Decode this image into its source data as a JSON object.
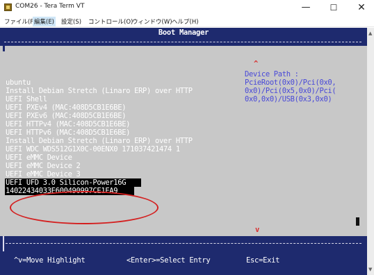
{
  "window": {
    "title": "COM26 - Tera Term VT",
    "minimize": "—",
    "maximize": "☐",
    "close": "✕"
  },
  "menu": [
    "ファイル(F)",
    "編集(E)",
    "設定(S)",
    "コントロール(O)",
    "ウィンドウ(W)",
    "ヘルプ(H)"
  ],
  "terminal": {
    "header_title": "Boot Manager",
    "entries": [
      "ubuntu",
      "Install Debian Stretch (Linaro ERP) over HTTP",
      "UEFI Shell",
      "UEFI PXEv4 (MAC:408D5CB1E6BE)",
      "UEFI PXEv6 (MAC:408D5CB1E6BE)",
      "UEFI HTTPv4 (MAC:408D5CB1E6BE)",
      "UEFI HTTPv6 (MAC:408D5CB1E6BE)",
      "Install Debian Stretch (Linaro ERP) over HTTP",
      "UEFI WDC WDS512G1X0C-00ENX0 171037421474 1",
      "UEFI eMMC Device",
      "UEFI eMMC Device 2",
      "UEFI eMMC Device 3"
    ],
    "selected_entry_line1": "UEFI UFD 3.0 Silicon-Power16G",
    "selected_entry_line2": "14022434033E600490997CE1EA9",
    "device_path_label": "Device Path :",
    "device_path_lines": [
      "PcieRoot(0x0)/Pci(0x0,",
      "0x0)/Pci(0x5,0x0)/Pci(",
      "0x0,0x0)/USB(0x3,0x0)"
    ],
    "scroll_up": "^",
    "scroll_down": "v",
    "footer_move": "^v=Move Highlight",
    "footer_select": "<Enter>=Select Entry",
    "footer_exit": "Esc=Exit"
  },
  "colors": {
    "terminal_background": "#c8c8c8",
    "band_blue": "#1e2a6e",
    "device_path_text": "#4848d8",
    "annotation_red": "#d42020"
  }
}
